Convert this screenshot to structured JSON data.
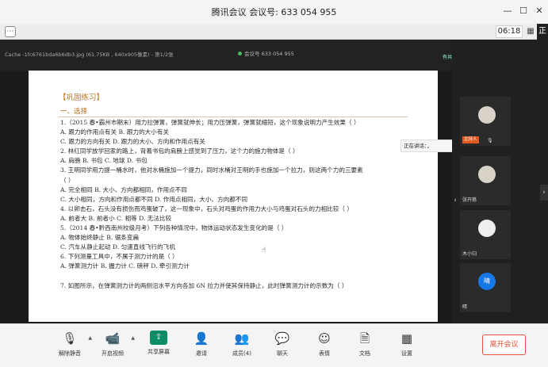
{
  "window": {
    "title": "腾讯会议 会议号: 633 054 955"
  },
  "toolbar": {
    "timer": "06:18",
    "sharing_label": "正在"
  },
  "viewer": {
    "file_title": "Cache -1fc6761bda6b6db3.jpg (61.75KB , 640x905像素) - 第1/2张",
    "meeting_tag": "会议号 633 054 955",
    "presenter_tag": "有共享画面"
  },
  "document": {
    "section_title": "【巩固练习】",
    "section_sub": "一、选择",
    "lines": [
      "1.（2015 春•霸州市期末）用力拉弹簧，弹簧就伸长；用力压弹簧，弹簧就缩短，这个现象说明力产生效果（     ）",
      "A.  跟力的作用点有关                        B.  跟力的大小有关",
      "C.  跟力的方向有关                          D.  跟力的大小、方向和作用点有关",
      "2. 林红同学放学回家的路上，背着书包的肩膀上感觉到了压力，这个力的施力物体是（     ）",
      "A.  肩膀              B.  书包              C.  地球              D.  书包",
      "3. 王明同学用力提一桶水时，他对水桶施加一个提力，同时水桶对王明的手也施加一个拉力，则这两个力的三要素",
      "（     ）",
      "A. 完全相同                                  B. 大小、方向都相同，作用点不同",
      "C. 大小相同，方向和作用点都不同              D. 作用点相同，大小、方向都不同",
      "4. 以卵击石，石头没有损伤而鸡蛋破了，这一现象中，石头对鸡蛋的作用力大小与鸡蛋对石头的力相比较（     ）",
      "A.  前者大               B.  前者小              C.  相等              D.  无法比较",
      "5.（2014 春•黔西南州校级月考）下列各种情况中，物体运动状态发生变化的是（     ）",
      "A.  物体始终静止                            B.  锯条变扁",
      "C.  汽车从静止起动                          D.  匀速直线飞行的飞机",
      "6. 下列测量工具中，不属于测力计的是（     ）",
      "A. 弹簧测力计            B. 握力计              C. 磅秤               D. 牵引测力计",
      "",
      "7. 如图所示，在弹簧测力计的两侧沿水平方向各加 6N 拉力并使其保持静止，此时弹簧测力计的示数为（     ）"
    ]
  },
  "participants": {
    "speaking_tip": "正在讲话：，",
    "tiles": [
      {
        "name": "",
        "host_label": "主持人",
        "avatar": ""
      },
      {
        "name": "张开慈",
        "avatar": ""
      },
      {
        "name": "木小归",
        "avatar": ""
      },
      {
        "name": "晴",
        "avatar": "晴"
      }
    ]
  },
  "controls": {
    "mute": "解除静音",
    "video": "开启视频",
    "share": "共享屏幕",
    "invite": "邀请",
    "members": "成员(4)",
    "chat": "聊天",
    "emoji": "表情",
    "docs": "文档",
    "settings": "设置",
    "leave": "离开会议"
  },
  "colors": {
    "leave": "#e5533d",
    "share": "#0e8c66",
    "host": "#e05a1f",
    "avatar_blue": "#1677e6",
    "section": "#b7761a"
  }
}
